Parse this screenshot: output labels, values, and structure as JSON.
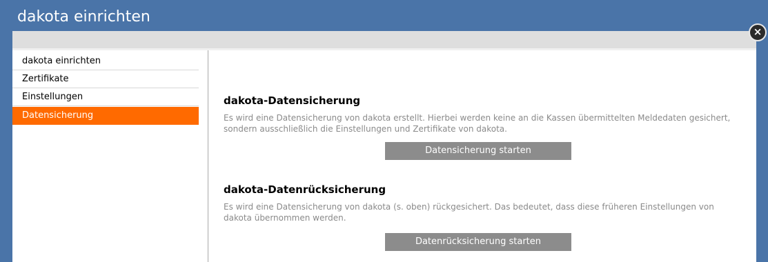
{
  "window": {
    "title": "dakota einrichten",
    "close_symbol": "×"
  },
  "sidebar": {
    "items": [
      {
        "label": "dakota einrichten",
        "active": false
      },
      {
        "label": "Zertifikate",
        "active": false
      },
      {
        "label": "Einstellungen",
        "active": false
      },
      {
        "label": "Datensicherung",
        "active": true
      }
    ]
  },
  "main": {
    "backup": {
      "heading": "dakota-Datensicherung",
      "text": "Es wird eine Datensicherung von dakota erstellt. Hierbei werden keine an die Kassen übermittelten Meldedaten gesichert, sondern ausschließlich die Einstellungen und Zertifikate von dakota.",
      "button_label": "Datensicherung starten"
    },
    "restore": {
      "heading": "dakota-Datenrücksicherung",
      "text": "Es wird eine Datensicherung von dakota (s. oben) rückgesichert. Das bedeutet, dass diese früheren Einstellungen von dakota übernommen werden.",
      "button_label": "Datenrücksicherung starten"
    }
  },
  "colors": {
    "titlebar": "#4a74a8",
    "active_item": "#ff6a00",
    "button": "#8c8c8c"
  },
  "icons": {
    "close": "close-icon"
  }
}
